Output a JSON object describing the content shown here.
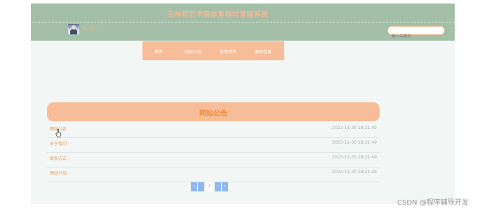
{
  "header": {
    "site_title": "玉林师范学院体育器材管理系统",
    "username": "黄vip2",
    "user_dropdown_symbol": "⌄",
    "search_placeholder": "输入关键词"
  },
  "nav": {
    "items": [
      {
        "label": "首页"
      },
      {
        "label": "网站公告"
      },
      {
        "label": "体育资讯"
      },
      {
        "label": "器材信息"
      }
    ]
  },
  "notice": {
    "title": "网站公告",
    "items": [
      {
        "title": "网站公告",
        "date": "2023-11-30 18:21:49"
      },
      {
        "title": "关于我们",
        "date": "2023-11-30 18:21:49"
      },
      {
        "title": "联系方式",
        "date": "2023-11-30 18:21:49"
      },
      {
        "title": "网站介绍",
        "date": "2023-11-30 18:21:49"
      }
    ]
  },
  "pagination": {
    "first": "«",
    "prev": "‹",
    "current": "1",
    "next": "›",
    "last": "»"
  },
  "watermark": "CSDN @程序辅导开发",
  "colors": {
    "header_bg": "#a3bfa8",
    "accent": "#f7bd98",
    "title_text": "#f2b694",
    "link_text": "#e69a52",
    "pager": "#8fb6ef"
  }
}
